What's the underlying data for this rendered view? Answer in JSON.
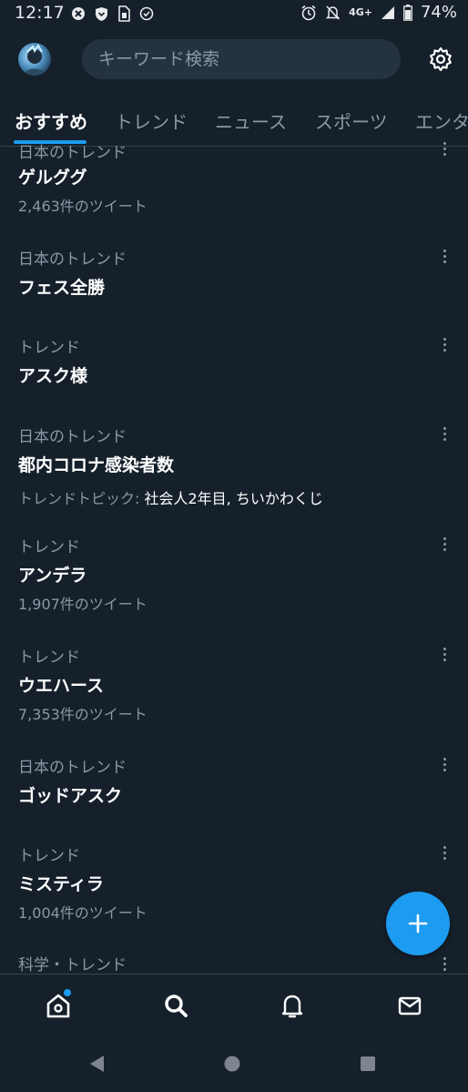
{
  "status_bar": {
    "time": "12:17",
    "network": "4G+",
    "battery": "74%"
  },
  "header": {
    "search_placeholder": "キーワード検索"
  },
  "tabs": [
    {
      "label": "おすすめ",
      "active": true
    },
    {
      "label": "トレンド",
      "active": false
    },
    {
      "label": "ニュース",
      "active": false
    },
    {
      "label": "スポーツ",
      "active": false
    },
    {
      "label": "エンタ",
      "active": false
    }
  ],
  "trends": [
    {
      "category": "日本のトレンド",
      "name": "ゲルググ",
      "tweets": "2,463件のツイート"
    },
    {
      "category": "日本のトレンド",
      "name": "フェス全勝"
    },
    {
      "category": "トレンド",
      "name": "アスク様"
    },
    {
      "category": "日本のトレンド",
      "name": "都内コロナ感染者数",
      "topics_label": "トレンドトピック:",
      "topics": "社会人2年目, ちいかわくじ"
    },
    {
      "category": "トレンド",
      "name": "アンデラ",
      "tweets": "1,907件のツイート"
    },
    {
      "category": "トレンド",
      "name": "ウエハース",
      "tweets": "7,353件のツイート"
    },
    {
      "category": "日本のトレンド",
      "name": "ゴッドアスク"
    },
    {
      "category": "トレンド",
      "name": "ミスティラ",
      "tweets": "1,004件のツイート"
    },
    {
      "category": "科学・トレンド"
    }
  ],
  "icons": {
    "settings": "gear-icon",
    "compose": "plus-icon",
    "nav": [
      "home-icon",
      "search-icon",
      "bell-icon",
      "mail-icon"
    ],
    "android": [
      "back-icon",
      "home-circle-icon",
      "recents-icon"
    ]
  },
  "colors": {
    "background": "#15202b",
    "accent": "#1d9bf0",
    "secondary_text": "#8b98a5"
  }
}
